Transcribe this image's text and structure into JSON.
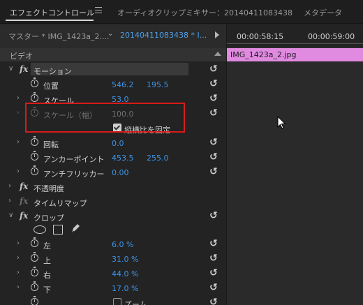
{
  "tabs": {
    "effect_controls": "エフェクトコントロール",
    "audio_mixer": "オーディオクリップミキサー：20140411083438",
    "metadata": "メタデータ"
  },
  "source": {
    "master": "マスター * IMG_1423a_2....",
    "clip": "20140411083438 * I..."
  },
  "section_video": "ビデオ",
  "timeline": {
    "tc_start": "00:00:58:15",
    "tc_end": "00:00:59:00",
    "clip_name": "IMG_1423a_2.jpg"
  },
  "effects": {
    "motion": {
      "label": "モーション",
      "position": {
        "label": "位置",
        "x": "546.2",
        "y": "195.5"
      },
      "scale": {
        "label": "スケール",
        "value": "53.0"
      },
      "scale_width": {
        "label": "スケール（幅）",
        "value": "100.0"
      },
      "uniform_scale": {
        "label": "縦横比を固定",
        "checked": true
      },
      "rotation": {
        "label": "回転",
        "value": "0.0"
      },
      "anchor": {
        "label": "アンカーポイント",
        "x": "453.5",
        "y": "255.0"
      },
      "antiflicker": {
        "label": "アンチフリッカー",
        "value": "0.00"
      }
    },
    "opacity": {
      "label": "不透明度"
    },
    "time_remap": {
      "label": "タイムリマップ"
    },
    "crop": {
      "label": "クロップ",
      "left": {
        "label": "左",
        "value": "6.0 %"
      },
      "top": {
        "label": "上",
        "value": "31.0 %"
      },
      "right": {
        "label": "右",
        "value": "44.0 %"
      },
      "bottom": {
        "label": "下",
        "value": "17.0 %"
      },
      "zoom": {
        "label": "ズーム"
      }
    }
  },
  "colors": {
    "accent_blue": "#3e93e8",
    "highlight_red": "#d81b1b",
    "clip_pink": "#e08ae0"
  }
}
